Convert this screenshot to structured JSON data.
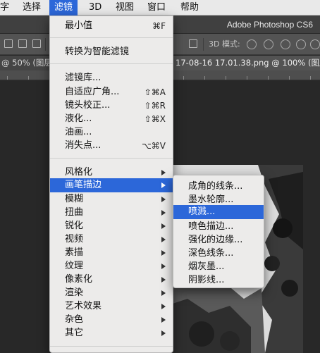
{
  "menubar": {
    "items": [
      {
        "label": "字"
      },
      {
        "label": "选择"
      },
      {
        "label": "滤镜"
      },
      {
        "label": "3D"
      },
      {
        "label": "视图"
      },
      {
        "label": "窗口"
      },
      {
        "label": "帮助"
      }
    ]
  },
  "appbar": {
    "title": "Adobe Photoshop CS6"
  },
  "optionsbar": {
    "mode_label": "3D 模式:"
  },
  "tabs": {
    "left": "@ 50% (图层",
    "right": "17-08-16 17.01.38.png @ 100% (图层",
    "close_glyph": "×"
  },
  "filter_menu": {
    "items": [
      {
        "label": "最小值",
        "shortcut": "⌘F"
      },
      {
        "label": "转换为智能滤镜"
      },
      {
        "label": "滤镜库..."
      },
      {
        "label": "自适应广角...",
        "shortcut": "⇧⌘A"
      },
      {
        "label": "镜头校正...",
        "shortcut": "⇧⌘R"
      },
      {
        "label": "液化...",
        "shortcut": "⇧⌘X"
      },
      {
        "label": "油画..."
      },
      {
        "label": "消失点...",
        "shortcut": "⌥⌘V"
      },
      {
        "label": "风格化"
      },
      {
        "label": "画笔描边"
      },
      {
        "label": "模糊"
      },
      {
        "label": "扭曲"
      },
      {
        "label": "锐化"
      },
      {
        "label": "视频"
      },
      {
        "label": "素描"
      },
      {
        "label": "纹理"
      },
      {
        "label": "像素化"
      },
      {
        "label": "渲染"
      },
      {
        "label": "艺术效果"
      },
      {
        "label": "杂色"
      },
      {
        "label": "其它"
      }
    ]
  },
  "submenu": {
    "items": [
      {
        "label": "成角的线条..."
      },
      {
        "label": "墨水轮廓..."
      },
      {
        "label": "喷溅..."
      },
      {
        "label": "喷色描边..."
      },
      {
        "label": "强化的边缘..."
      },
      {
        "label": "深色线条..."
      },
      {
        "label": "烟灰墨..."
      },
      {
        "label": "阴影线..."
      }
    ]
  },
  "colors": {
    "highlight": "#2c67d9",
    "menu_bg": "#ecebea",
    "menubar_bg": "#e9e9e9",
    "ps_dark": "#282828"
  }
}
